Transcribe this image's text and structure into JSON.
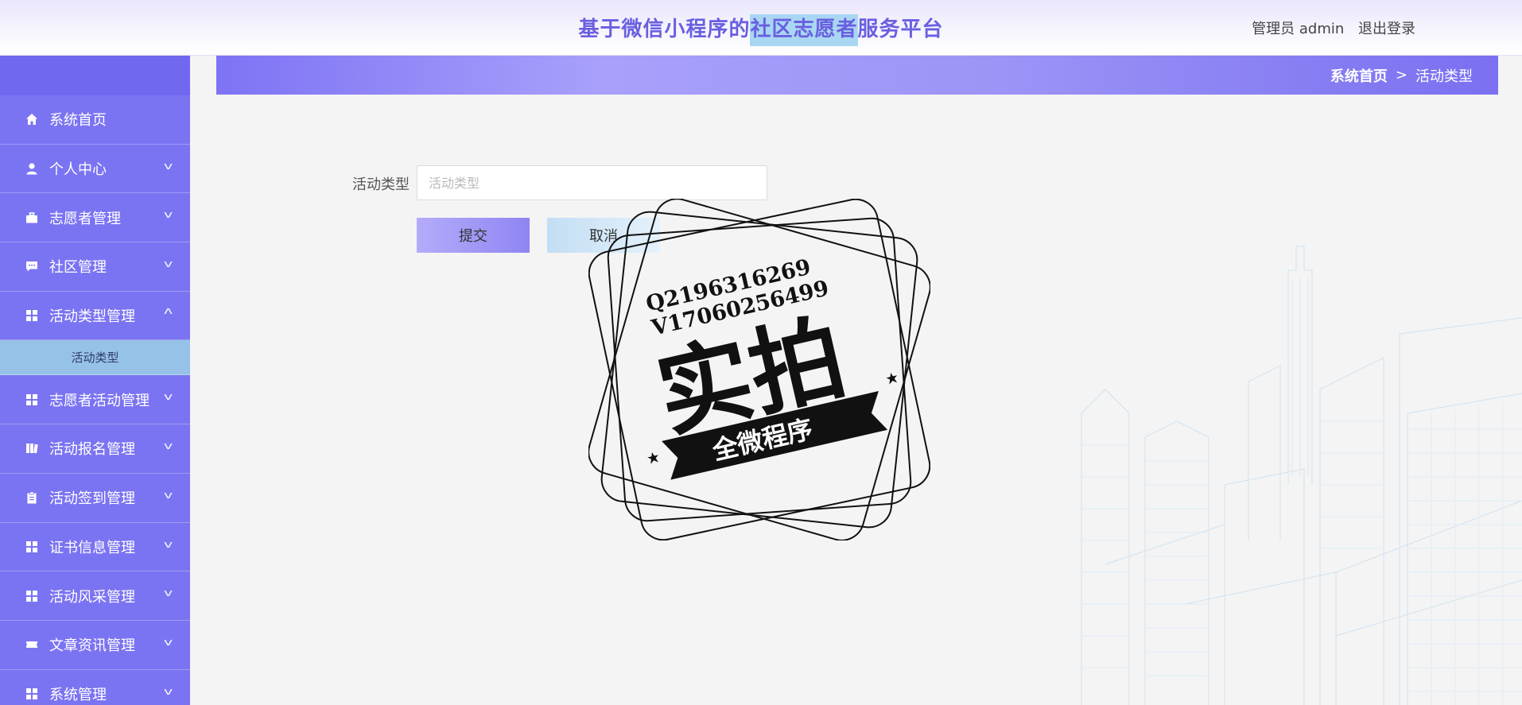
{
  "header": {
    "title_prefix": "基于微信小程序的",
    "title_highlight": "社区志愿者",
    "title_suffix": "服务平台",
    "user_label": "管理员 admin",
    "logout_label": "退出登录"
  },
  "sidebar": {
    "items": [
      {
        "label": "系统首页",
        "icon": "home-icon"
      },
      {
        "label": "个人中心",
        "icon": "person-icon"
      },
      {
        "label": "志愿者管理",
        "icon": "briefcase-icon"
      },
      {
        "label": "社区管理",
        "icon": "chat-icon"
      },
      {
        "label": "活动类型管理",
        "icon": "grid-icon"
      },
      {
        "label": "志愿者活动管理",
        "icon": "grid-icon"
      },
      {
        "label": "活动报名管理",
        "icon": "book-icon"
      },
      {
        "label": "活动签到管理",
        "icon": "clipboard-icon"
      },
      {
        "label": "证书信息管理",
        "icon": "grid-icon"
      },
      {
        "label": "活动风采管理",
        "icon": "grid-icon"
      },
      {
        "label": "文章资讯管理",
        "icon": "ticket-icon"
      },
      {
        "label": "系统管理",
        "icon": "grid-icon"
      }
    ],
    "submenu_active": "活动类型"
  },
  "breadcrumb": {
    "home": "系统首页",
    "separator": ">",
    "current": "活动类型"
  },
  "form": {
    "field_label": "活动类型",
    "field_placeholder": "活动类型",
    "field_value": "",
    "submit_label": "提交",
    "cancel_label": "取消"
  },
  "watermark": {
    "line1": "Q2196316269",
    "line2": "V17060256499",
    "main": "实拍",
    "ribbon": "全微程序"
  },
  "colors": {
    "accent": "#7b74f2",
    "title": "#6a5fe0",
    "submenu_active_bg": "#97c2e8"
  }
}
